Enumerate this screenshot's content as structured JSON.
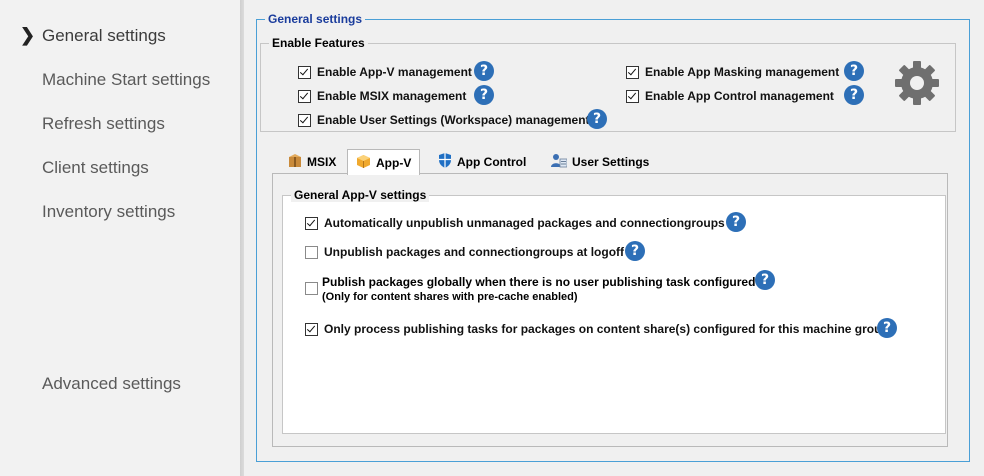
{
  "sidebar": {
    "items": [
      {
        "label": "General settings"
      },
      {
        "label": "Machine Start settings"
      },
      {
        "label": "Refresh settings"
      },
      {
        "label": "Client settings"
      },
      {
        "label": "Inventory settings"
      },
      {
        "label": "Advanced settings"
      }
    ]
  },
  "general": {
    "title": "General settings",
    "features": {
      "title": "Enable Features",
      "items": [
        {
          "label": "Enable App-V management",
          "checked": true
        },
        {
          "label": "Enable MSIX management",
          "checked": true
        },
        {
          "label": "Enable User Settings (Workspace) management",
          "checked": true
        },
        {
          "label": "Enable App Masking management",
          "checked": true
        },
        {
          "label": "Enable App Control management",
          "checked": true
        }
      ]
    },
    "tabs": [
      {
        "label": "MSIX",
        "icon": "package-icon"
      },
      {
        "label": "App-V",
        "icon": "appv-package-icon",
        "active": true
      },
      {
        "label": "App Control",
        "icon": "shield-icon"
      },
      {
        "label": "User Settings",
        "icon": "user-settings-icon"
      }
    ],
    "appv": {
      "title": "General App-V settings",
      "options": [
        {
          "label": "Automatically unpublish unmanaged packages and connectiongroups",
          "checked": true
        },
        {
          "label": "Unpublish packages and connectiongroups at logoff",
          "checked": false
        },
        {
          "label": "Publish packages globally when there is no user publishing task configured",
          "sublabel": "(Only for content shares with pre-cache enabled)",
          "checked": false
        },
        {
          "label": "Only process publishing tasks for packages on content share(s) configured for this machine group",
          "checked": true
        }
      ]
    }
  },
  "help_symbol": "?",
  "colors": {
    "accent_border": "#4a9fd6",
    "help": "#2d6fb7",
    "title": "#1a3c9c"
  }
}
